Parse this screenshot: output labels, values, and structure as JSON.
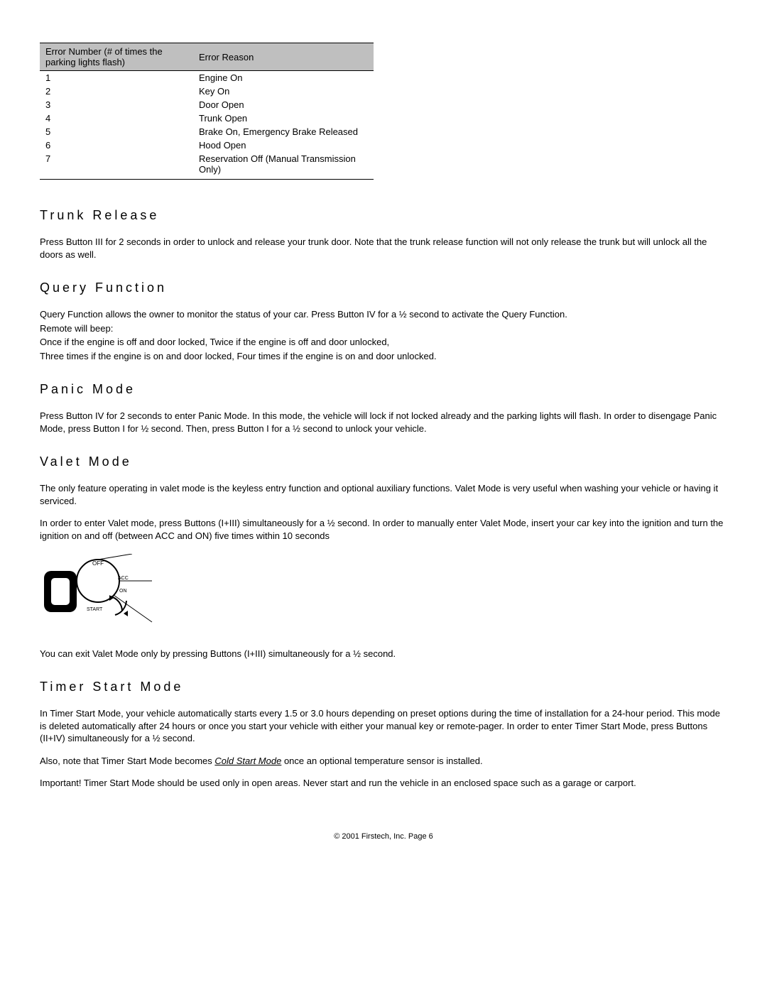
{
  "error_table": {
    "header_col1_a": "Error Number ",
    "header_col1_b": "(# of times the parking lights flash)",
    "header_col2": "Error Reason",
    "rows": [
      {
        "num": "1",
        "reason": "Engine On"
      },
      {
        "num": "2",
        "reason": "Key On"
      },
      {
        "num": "3",
        "reason": "Door Open"
      },
      {
        "num": "4",
        "reason": "Trunk Open"
      },
      {
        "num": "5",
        "reason": "Brake On, Emergency Brake Released"
      },
      {
        "num": "6",
        "reason": "Hood Open"
      },
      {
        "num": "7",
        "reason": "Reservation Off (Manual Transmission Only)"
      }
    ]
  },
  "sections": {
    "trunk_release": {
      "heading": "Trunk Release",
      "body": "Press Button III for 2 seconds in order to unlock and release your trunk door.  Note that the trunk release function will not only release the trunk but will unlock all the doors as well."
    },
    "query_function": {
      "heading": "Query Function",
      "p1": "Query Function allows the owner to monitor the status of your car. Press Button IV for a ½ second to activate the Query Function.",
      "p2": "Remote will beep:",
      "p3": "Once if the engine is off and door locked, Twice if the engine is off and door unlocked,",
      "p4": "Three times if the engine is on and door locked, Four times if the engine is on and door unlocked."
    },
    "panic_mode": {
      "heading": "Panic Mode",
      "body": "Press Button IV for 2 seconds to enter Panic Mode. In this mode, the vehicle will lock if not locked already and the parking lights will flash. In order to disengage Panic Mode, press Button I for ½ second. Then, press Button I for a ½ second to unlock your vehicle."
    },
    "valet_mode": {
      "heading": "Valet Mode",
      "p1": "The only feature operating in valet mode is the keyless entry function and optional auxiliary functions.  Valet Mode is very useful when washing your vehicle or having it serviced.",
      "p2": "In order to enter Valet mode, press Buttons (I+III) simultaneously for a ½ second.  In order to manually enter Valet Mode, insert your car key into the ignition and turn the ignition on and off (between ACC and ON) five times within 10 seconds",
      "p3": "You can exit Valet Mode only by pressing Buttons (I+III) simultaneously for a ½ second."
    },
    "timer_start_mode": {
      "heading": "Timer Start Mode",
      "p1": "In Timer Start Mode, your vehicle automatically starts every 1.5 or 3.0 hours depending on preset options during the time of installation for a 24-hour period. This mode is deleted automatically after 24 hours or once you start your vehicle with either your manual key or remote-pager. In order to enter Timer Start Mode, press Buttons (II+IV) simultaneously for a ½ second.",
      "p2a": "Also, note that Timer Start Mode becomes ",
      "p2b": "Cold Start Mode",
      "p2c": " once an optional temperature sensor is installed.",
      "p3a": "Important!",
      "p3b": " Timer Start Mode should be used only in open areas. Never start and run the vehicle in an enclosed space such as a garage or carport."
    }
  },
  "diagram_labels": {
    "off": "OFF",
    "acc": "ACC",
    "on": "ON",
    "start": "START"
  },
  "footer": "© 2001 Firstech, Inc.  Page 6"
}
